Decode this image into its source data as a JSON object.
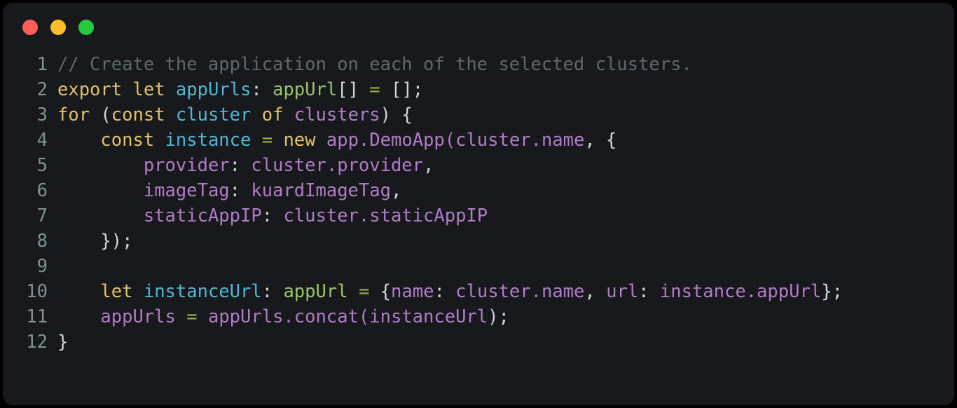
{
  "window": {
    "controls": [
      {
        "name": "close",
        "color": "#ff5f56"
      },
      {
        "name": "minimize",
        "color": "#ffbd2e"
      },
      {
        "name": "maximize",
        "color": "#27c93f"
      }
    ]
  },
  "editor": {
    "background": "#17191c",
    "gutter_color": "#7d9296",
    "language": "typescript",
    "token_colors": {
      "comment": "#5c6a70",
      "keyword": "#e3c168",
      "variable": "#4fb6d6",
      "type": "#98c36b",
      "operator": "#9ab43f",
      "identifier": "#b07cc6",
      "punctuation": "#d4d7da"
    },
    "lines": [
      {
        "number": "1",
        "text": "// Create the application on each of the selected clusters.",
        "tokens": [
          {
            "t": "// Create the application on each of the selected clusters.",
            "c": "t-comment"
          }
        ]
      },
      {
        "number": "2",
        "text": "export let appUrls: appUrl[] = [];",
        "tokens": [
          {
            "t": "export",
            "c": "t-keyword"
          },
          {
            "t": " ",
            "c": "t-plain"
          },
          {
            "t": "let",
            "c": "t-keyword"
          },
          {
            "t": " ",
            "c": "t-plain"
          },
          {
            "t": "appUrls",
            "c": "t-var"
          },
          {
            "t": ":",
            "c": "t-punct"
          },
          {
            "t": " ",
            "c": "t-plain"
          },
          {
            "t": "appUrl",
            "c": "t-type"
          },
          {
            "t": "[]",
            "c": "t-punct"
          },
          {
            "t": " ",
            "c": "t-plain"
          },
          {
            "t": "=",
            "c": "t-op"
          },
          {
            "t": " ",
            "c": "t-plain"
          },
          {
            "t": "[];",
            "c": "t-punct"
          }
        ]
      },
      {
        "number": "3",
        "text": "for (const cluster of clusters) {",
        "tokens": [
          {
            "t": "for",
            "c": "t-keyword"
          },
          {
            "t": " ",
            "c": "t-plain"
          },
          {
            "t": "(",
            "c": "t-punct"
          },
          {
            "t": "const",
            "c": "t-keyword"
          },
          {
            "t": " ",
            "c": "t-plain"
          },
          {
            "t": "cluster",
            "c": "t-var"
          },
          {
            "t": " ",
            "c": "t-plain"
          },
          {
            "t": "of",
            "c": "t-keyword"
          },
          {
            "t": " ",
            "c": "t-plain"
          },
          {
            "t": "clusters",
            "c": "t-ident"
          },
          {
            "t": ") {",
            "c": "t-punct"
          }
        ]
      },
      {
        "number": "4",
        "text": "    const instance = new app.DemoApp(cluster.name, {",
        "tokens": [
          {
            "t": "    ",
            "c": "t-plain"
          },
          {
            "t": "const",
            "c": "t-keyword"
          },
          {
            "t": " ",
            "c": "t-plain"
          },
          {
            "t": "instance",
            "c": "t-var"
          },
          {
            "t": " ",
            "c": "t-plain"
          },
          {
            "t": "=",
            "c": "t-op"
          },
          {
            "t": " ",
            "c": "t-plain"
          },
          {
            "t": "new",
            "c": "t-keyword"
          },
          {
            "t": " ",
            "c": "t-plain"
          },
          {
            "t": "app.DemoApp(cluster.name",
            "c": "t-ident"
          },
          {
            "t": ", {",
            "c": "t-punct"
          }
        ]
      },
      {
        "number": "5",
        "text": "        provider: cluster.provider,",
        "tokens": [
          {
            "t": "        ",
            "c": "t-plain"
          },
          {
            "t": "provider",
            "c": "t-ident"
          },
          {
            "t": ":",
            "c": "t-punct"
          },
          {
            "t": " ",
            "c": "t-plain"
          },
          {
            "t": "cluster.provider",
            "c": "t-ident"
          },
          {
            "t": ",",
            "c": "t-punct"
          }
        ]
      },
      {
        "number": "6",
        "text": "        imageTag: kuardImageTag,",
        "tokens": [
          {
            "t": "        ",
            "c": "t-plain"
          },
          {
            "t": "imageTag",
            "c": "t-ident"
          },
          {
            "t": ":",
            "c": "t-punct"
          },
          {
            "t": " ",
            "c": "t-plain"
          },
          {
            "t": "kuardImageTag",
            "c": "t-ident"
          },
          {
            "t": ",",
            "c": "t-punct"
          }
        ]
      },
      {
        "number": "7",
        "text": "        staticAppIP: cluster.staticAppIP",
        "tokens": [
          {
            "t": "        ",
            "c": "t-plain"
          },
          {
            "t": "staticAppIP",
            "c": "t-ident"
          },
          {
            "t": ":",
            "c": "t-punct"
          },
          {
            "t": " ",
            "c": "t-plain"
          },
          {
            "t": "cluster.staticAppIP",
            "c": "t-ident"
          }
        ]
      },
      {
        "number": "8",
        "text": "    });",
        "tokens": [
          {
            "t": "    ",
            "c": "t-plain"
          },
          {
            "t": "});",
            "c": "t-punct"
          }
        ]
      },
      {
        "number": "9",
        "text": "",
        "tokens": []
      },
      {
        "number": "10",
        "text": "    let instanceUrl: appUrl = {name: cluster.name, url: instance.appUrl};",
        "tokens": [
          {
            "t": "    ",
            "c": "t-plain"
          },
          {
            "t": "let",
            "c": "t-keyword"
          },
          {
            "t": " ",
            "c": "t-plain"
          },
          {
            "t": "instanceUrl",
            "c": "t-var"
          },
          {
            "t": ":",
            "c": "t-punct"
          },
          {
            "t": " ",
            "c": "t-plain"
          },
          {
            "t": "appUrl",
            "c": "t-type"
          },
          {
            "t": " ",
            "c": "t-plain"
          },
          {
            "t": "=",
            "c": "t-op"
          },
          {
            "t": " ",
            "c": "t-plain"
          },
          {
            "t": "{",
            "c": "t-punct"
          },
          {
            "t": "name",
            "c": "t-ident"
          },
          {
            "t": ":",
            "c": "t-punct"
          },
          {
            "t": " ",
            "c": "t-plain"
          },
          {
            "t": "cluster.name",
            "c": "t-ident"
          },
          {
            "t": ",",
            "c": "t-punct"
          },
          {
            "t": " ",
            "c": "t-plain"
          },
          {
            "t": "url",
            "c": "t-ident"
          },
          {
            "t": ":",
            "c": "t-punct"
          },
          {
            "t": " ",
            "c": "t-plain"
          },
          {
            "t": "instance.appUrl",
            "c": "t-ident"
          },
          {
            "t": "};",
            "c": "t-punct"
          }
        ]
      },
      {
        "number": "11",
        "text": "    appUrls = appUrls.concat(instanceUrl);",
        "tokens": [
          {
            "t": "    ",
            "c": "t-plain"
          },
          {
            "t": "appUrls",
            "c": "t-ident"
          },
          {
            "t": " ",
            "c": "t-plain"
          },
          {
            "t": "=",
            "c": "t-op"
          },
          {
            "t": " ",
            "c": "t-plain"
          },
          {
            "t": "appUrls.concat(instanceUrl",
            "c": "t-ident"
          },
          {
            "t": ");",
            "c": "t-punct"
          }
        ]
      },
      {
        "number": "12",
        "text": "}",
        "tokens": [
          {
            "t": "}",
            "c": "t-punct"
          }
        ]
      }
    ]
  }
}
